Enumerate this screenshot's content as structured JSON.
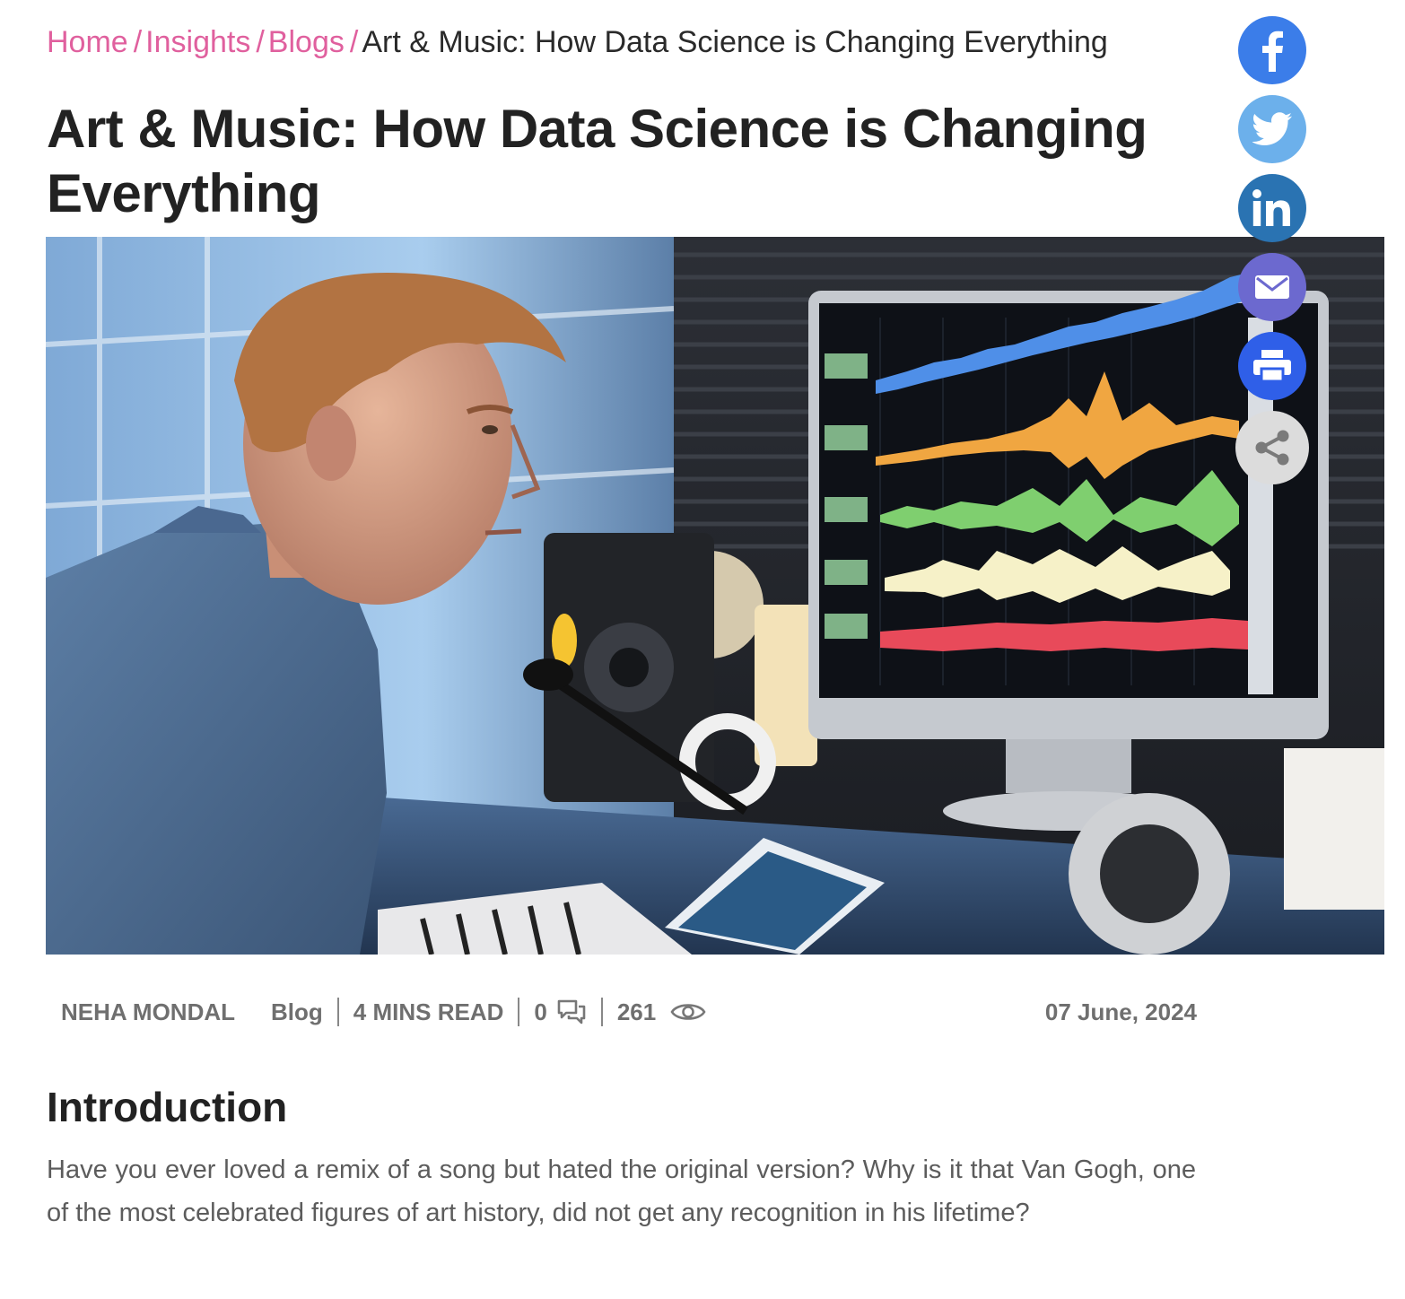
{
  "breadcrumb": {
    "home": "Home",
    "insights": "Insights",
    "blogs": "Blogs",
    "separator": "/",
    "current": "Art & Music: How Data Science is Changing Everything"
  },
  "article": {
    "title": "Art & Music: How Data Science is Changing Everything",
    "author": "NEHA MONDAL",
    "category": "Blog",
    "read_time": "4 MINS READ",
    "comments": "0",
    "views": "261",
    "date": "07 June, 2024"
  },
  "content": {
    "intro_heading": "Introduction",
    "intro_text": "Have you ever loved a remix of a song but hated the original version? Why is it that Van Gogh, one of the most celebrated figures of art history, did not get any recognition in his lifetime?"
  },
  "social": [
    {
      "name": "facebook",
      "icon": "facebook-icon",
      "color": "#3b7de9"
    },
    {
      "name": "twitter",
      "icon": "twitter-icon",
      "color": "#6cb0eb"
    },
    {
      "name": "linkedin",
      "icon": "linkedin-icon",
      "color": "#2a73b2"
    },
    {
      "name": "email",
      "icon": "mail-icon",
      "color": "#6c69cf"
    },
    {
      "name": "print",
      "icon": "printer-icon",
      "color": "#2f5fe8"
    },
    {
      "name": "share",
      "icon": "share-icon",
      "color": "#dcdcdc"
    }
  ],
  "hero_image": {
    "icon": "music-producer-photo"
  }
}
